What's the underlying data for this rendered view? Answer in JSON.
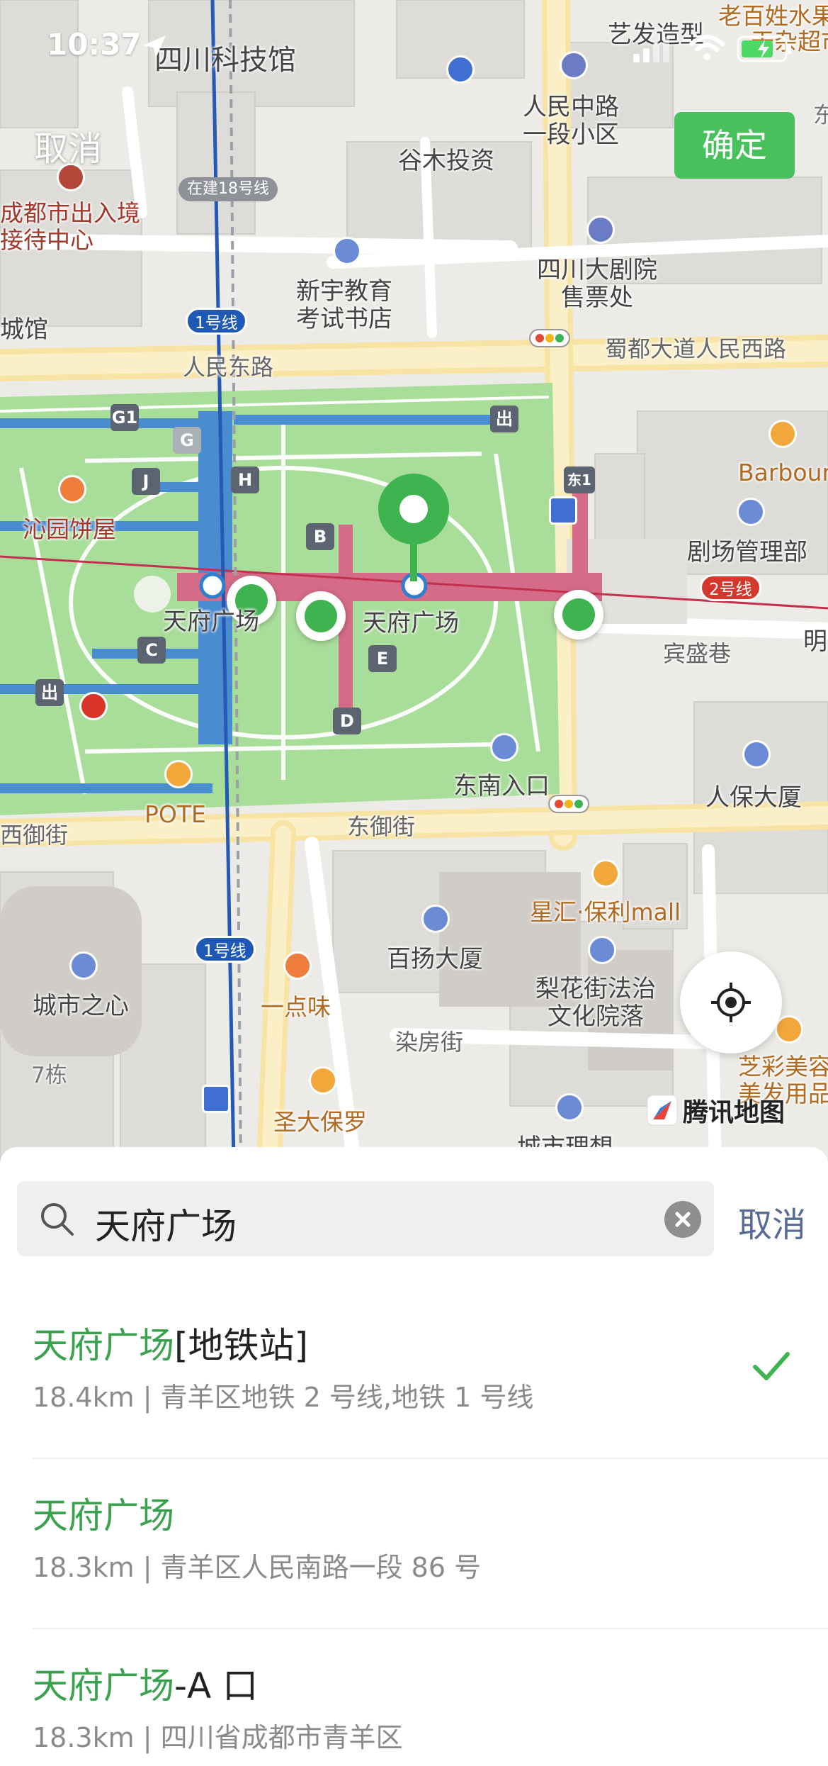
{
  "status_bar": {
    "time": "10:37"
  },
  "map": {
    "labels": {
      "sichuan_sci_museum": "四川科技馆",
      "arts_salon": "艺发造型",
      "laobaixing": "老百姓水果",
      "ganzajichaoshi": "干杂超市",
      "dong": "东",
      "renmin_community": "人民中路\n一段小区",
      "gumu": "谷木投资",
      "chengdu_exit_entry": "成都市出入境\n接待中心",
      "under_construction_18": "在建18号线",
      "xinyu_education": "新宇教育\n考试书店",
      "sichuan_theatre": "四川大剧院\n售票处",
      "chengguan": "城馆",
      "line1_badge_top": "1号线",
      "shudu_road": "蜀都大道人民西路",
      "renmin_east_road": "人民东路",
      "barbour": "Barbour",
      "qinyuan": "沁园饼屋",
      "theatre_mgmt": "剧场管理部",
      "line2_badge": "2号线",
      "tianfu_station_left": "天府广场",
      "tianfu_square": "天府广场",
      "binsheng_lane": "宾盛巷",
      "ming": "明",
      "southeast_entrance": "东南入口",
      "renbao_tower": "人保大厦",
      "pote": "POTE",
      "xiyu_street": "西御街",
      "dongyu_street": "东御街",
      "xinghui_poly": "星汇·保利mall",
      "line1_badge_bottom": "1号线",
      "baiyang_tower": "百扬大厦",
      "lihuajie": "梨花街法治\n文化院落",
      "chengshi_zhixin": "城市之心",
      "yidianwei": "一点味",
      "ranfang_street": "染房街",
      "zhicai": "芝彩美容\n美发用品",
      "qidong": "7栋",
      "shengdabaoluo": "圣大保罗",
      "chengshi_lixiang": "城市理想"
    },
    "exits": {
      "g1": "G1",
      "g": "G",
      "h": "H",
      "j": "J",
      "b": "B",
      "c": "C",
      "e": "E",
      "d": "D",
      "exit_right": "出",
      "exit_left": "出",
      "dong1": "东1"
    },
    "top_cancel_label": "取消",
    "confirm_label": "确定",
    "logo_text": "腾讯地图",
    "colors": {
      "metro_line1": "#1f59b5",
      "metro_line2": "#d4382c",
      "accent_green": "#48c15c",
      "park_green": "#a9dd9a"
    }
  },
  "search": {
    "query": "天府广场",
    "cancel_label": "取消"
  },
  "results": [
    {
      "title_highlight": "天府广场",
      "title_rest": "[地铁站]",
      "subtitle": "18.4km | 青羊区地铁 2 号线,地铁 1 号线",
      "selected": true
    },
    {
      "title_highlight": "天府广场",
      "title_rest": "",
      "subtitle": "18.3km | 青羊区人民南路一段 86 号",
      "selected": false
    },
    {
      "title_highlight": "天府广场",
      "title_rest": "-A 口",
      "subtitle": "18.3km | 四川省成都市青羊区",
      "selected": false
    }
  ]
}
